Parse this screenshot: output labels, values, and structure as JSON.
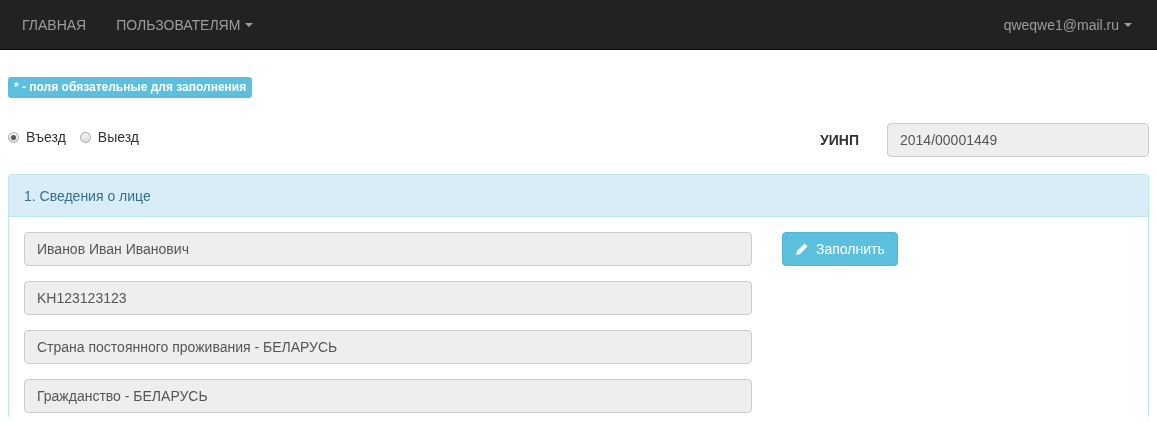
{
  "navbar": {
    "items": [
      {
        "label": "ГЛАВНАЯ",
        "dropdown": false
      },
      {
        "label": "ПОЛЬЗОВАТЕЛЯМ",
        "dropdown": true
      }
    ],
    "user": {
      "label": "qweqwe1@mail.ru",
      "dropdown": true
    }
  },
  "required_note": "* - поля обязательные для заполнения",
  "direction": [
    {
      "label": "Въезд",
      "selected": true
    },
    {
      "label": "Выезд",
      "selected": false
    }
  ],
  "uinp": {
    "label": "УИНП",
    "value": "2014/00001449"
  },
  "panel": {
    "title": "1. Сведения о лице",
    "fields": [
      {
        "value": "Иванов Иван Иванович"
      },
      {
        "value": "KH123123123"
      },
      {
        "value": "Страна постоянного проживания - БЕЛАРУСЬ"
      },
      {
        "value": "Гражданство - БЕЛАРУСЬ"
      }
    ],
    "button": "Заполнить"
  }
}
